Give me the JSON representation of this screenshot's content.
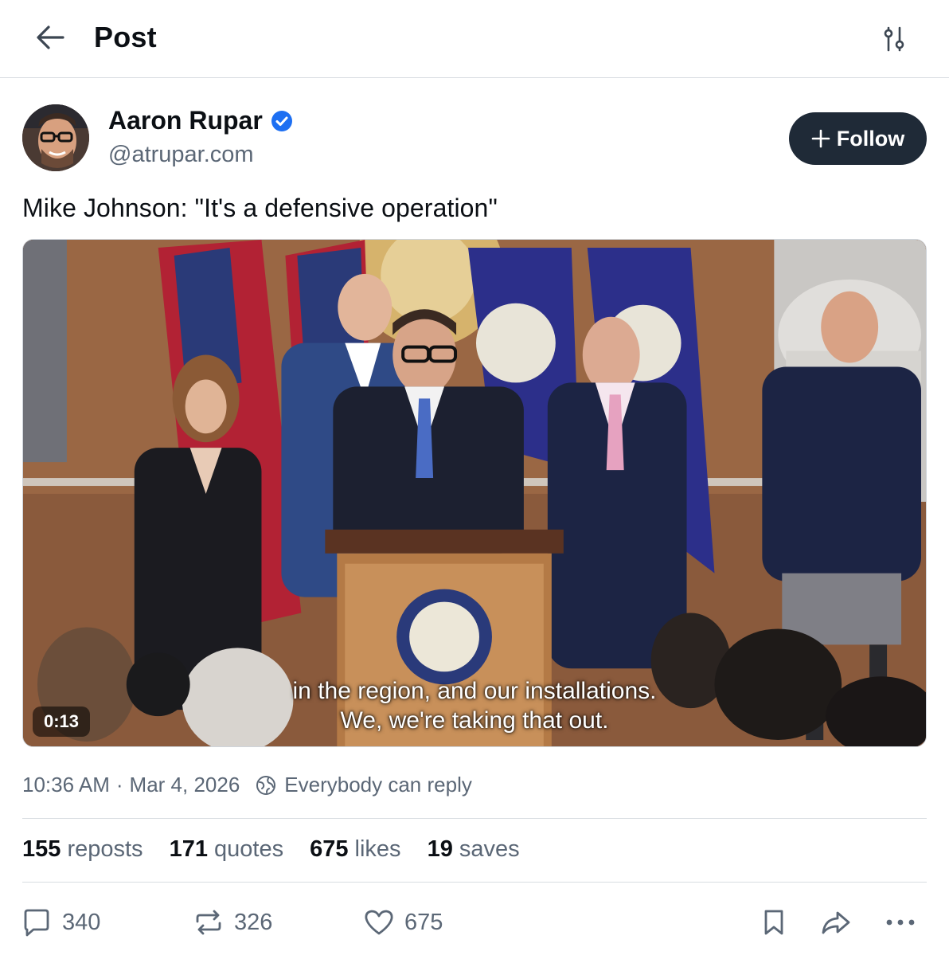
{
  "header": {
    "title": "Post",
    "back_icon": "arrow-left-icon",
    "filter_icon": "sliders-icon"
  },
  "author": {
    "name": "Aaron Rupar",
    "handle": "@atrupar.com",
    "verified": true,
    "verified_color": "#1d6ff2"
  },
  "follow_button": {
    "label": "Follow"
  },
  "post": {
    "text": "Mike Johnson: \"It's a defensive operation\""
  },
  "video": {
    "caption_line1": "in the region, and our installations.",
    "caption_line2": "We, we're taking that out.",
    "duration": "0:13"
  },
  "meta": {
    "time": "10:36 AM",
    "separator": "·",
    "date": "Mar 4, 2026",
    "reply_setting": "Everybody can reply"
  },
  "stats": [
    {
      "count": "155",
      "label": "reposts"
    },
    {
      "count": "171",
      "label": "quotes"
    },
    {
      "count": "675",
      "label": "likes"
    },
    {
      "count": "19",
      "label": "saves"
    }
  ],
  "actions": {
    "replies": "340",
    "reposts": "326",
    "likes": "675"
  },
  "colors": {
    "accent": "#1d6ff2",
    "follow_bg": "#1f2a37",
    "muted_text": "#5b6776",
    "divider": "#d9dde2"
  }
}
